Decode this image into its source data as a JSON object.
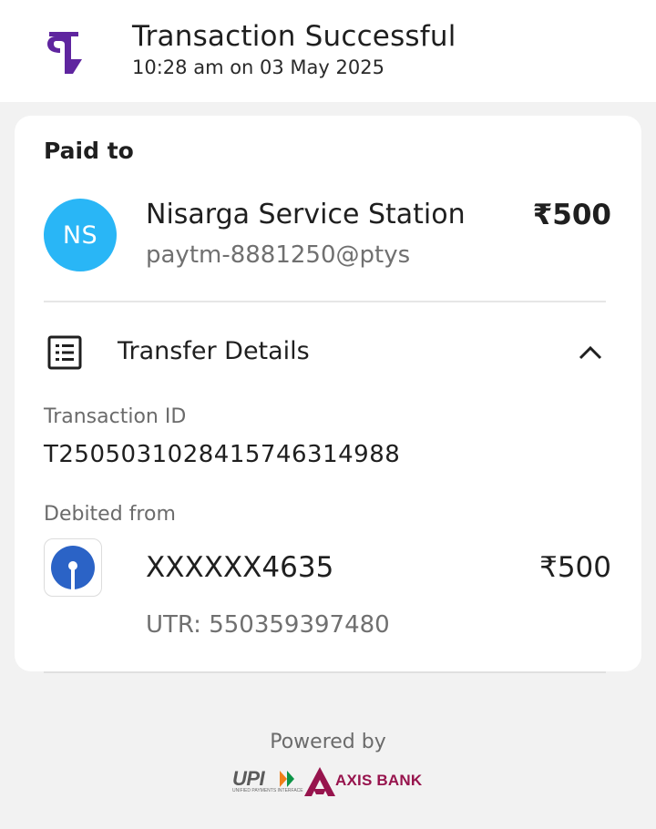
{
  "header": {
    "app_logo_icon": "phonepe-logo-icon",
    "title": "Transaction Successful",
    "timestamp": "10:28 am on 03 May 2025"
  },
  "paid_to": {
    "section_label": "Paid to",
    "avatar_initials": "NS",
    "avatar_color": "#29b6f6",
    "payee_name": "Nisarga Service Station",
    "payee_upi_id": "paytm-8881250@ptys",
    "amount": "₹500"
  },
  "transfer_details": {
    "label": "Transfer Details",
    "icon": "list-details-icon",
    "toggle_icon": "chevron-up-icon",
    "expanded": true,
    "transaction_id_label": "Transaction ID",
    "transaction_id": "T2505031028415746314988",
    "debited_from_label": "Debited from",
    "bank_icon": "sbi-logo-icon",
    "account_number": "XXXXXX4635",
    "debited_amount": "₹500",
    "utr": "UTR: 550359397480"
  },
  "footer": {
    "powered_by_label": "Powered by",
    "upi_logo_text": "UPI",
    "upi_tagline": "UNIFIED PAYMENTS INTERFACE",
    "bank_partner_text": "AXIS BANK"
  },
  "colors": {
    "brand_purple": "#5f259f",
    "axis_maroon": "#97144d",
    "sbi_blue": "#2b63c6"
  }
}
